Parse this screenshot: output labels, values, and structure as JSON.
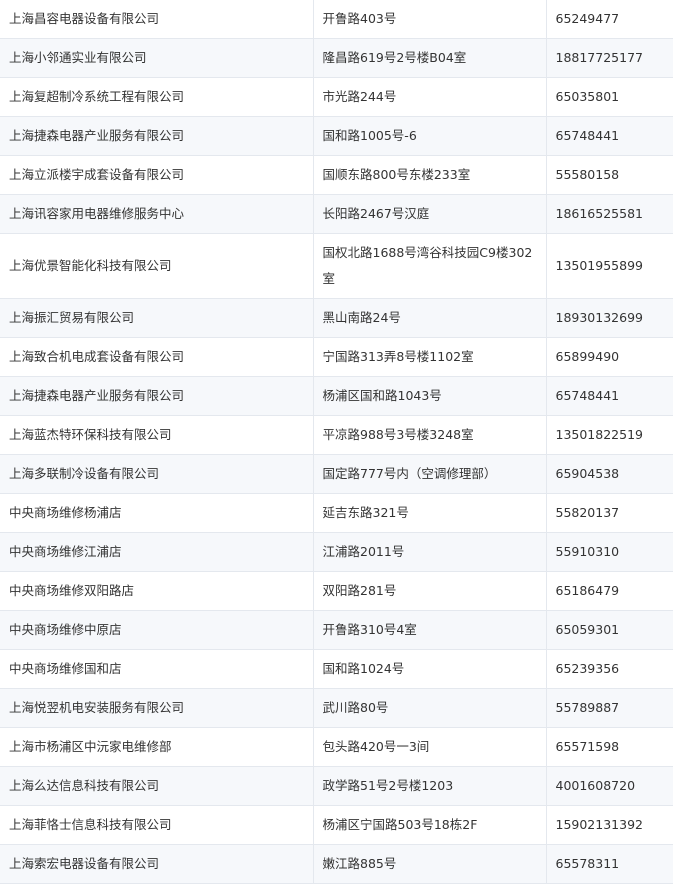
{
  "rows": [
    {
      "name": "上海昌容电器设备有限公司",
      "address": "开鲁路403号",
      "phone": "65249477"
    },
    {
      "name": "上海小邻通实业有限公司",
      "address": "隆昌路619号2号楼B04室",
      "phone": "18817725177"
    },
    {
      "name": "上海复超制冷系统工程有限公司",
      "address": "市光路244号",
      "phone": "65035801"
    },
    {
      "name": "上海捷森电器产业服务有限公司",
      "address": "国和路1005号-6",
      "phone": "65748441"
    },
    {
      "name": "上海立派楼宇成套设备有限公司",
      "address": "国顺东路800号东楼233室",
      "phone": "55580158"
    },
    {
      "name": "上海讯容家用电器维修服务中心",
      "address": "长阳路2467号汉庭",
      "phone": "18616525581"
    },
    {
      "name": "上海优景智能化科技有限公司",
      "address": "国权北路1688号湾谷科技园C9楼302室",
      "phone": "13501955899"
    },
    {
      "name": "上海振汇贸易有限公司",
      "address": "黑山南路24号",
      "phone": "18930132699"
    },
    {
      "name": "上海致合机电成套设备有限公司",
      "address": "宁国路313弄8号楼1102室",
      "phone": "65899490"
    },
    {
      "name": "上海捷森电器产业服务有限公司",
      "address": "杨浦区国和路1043号",
      "phone": "65748441"
    },
    {
      "name": "上海蓝杰特环保科技有限公司",
      "address": "平凉路988号3号楼3248室",
      "phone": "13501822519"
    },
    {
      "name": "上海多联制冷设备有限公司",
      "address": "国定路777号内（空调修理部）",
      "phone": "65904538"
    },
    {
      "name": "中央商场维修杨浦店",
      "address": "延吉东路321号",
      "phone": "55820137"
    },
    {
      "name": "中央商场维修江浦店",
      "address": "江浦路2011号",
      "phone": "55910310"
    },
    {
      "name": "中央商场维修双阳路店",
      "address": "双阳路281号",
      "phone": "65186479"
    },
    {
      "name": "中央商场维修中原店",
      "address": "开鲁路310号4室",
      "phone": "65059301"
    },
    {
      "name": "中央商场维修国和店",
      "address": "国和路1024号",
      "phone": "65239356"
    },
    {
      "name": "上海悦翌机电安装服务有限公司",
      "address": "武川路80号",
      "phone": "55789887"
    },
    {
      "name": "上海市杨浦区中沅家电维修部",
      "address": "包头路420号一3间",
      "phone": "65571598"
    },
    {
      "name": "上海么达信息科技有限公司",
      "address": "政学路51号2号楼1203",
      "phone": "4001608720"
    },
    {
      "name": "上海菲恪士信息科技有限公司",
      "address": "杨浦区宁国路503号18栋2F",
      "phone": "15902131392"
    },
    {
      "name": "上海索宏电器设备有限公司",
      "address": "嫩江路885号",
      "phone": "65578311"
    }
  ]
}
